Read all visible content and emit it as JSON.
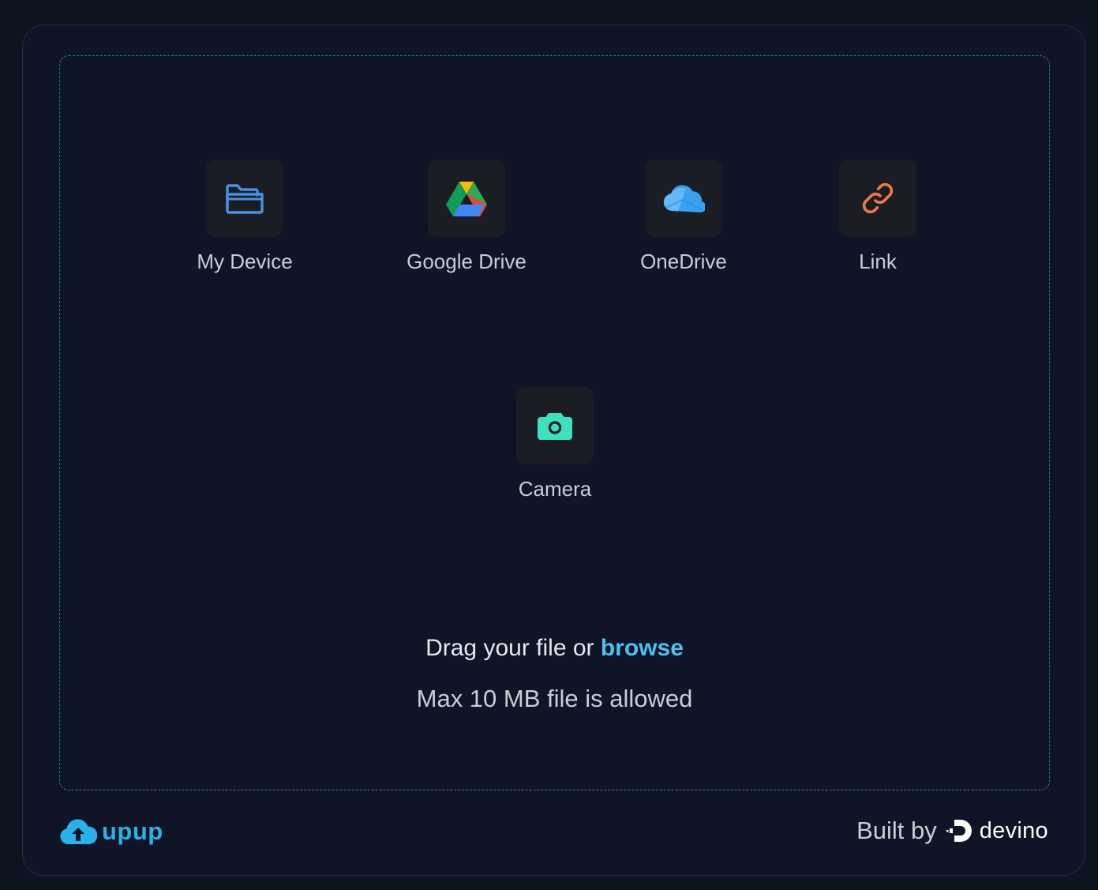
{
  "sources": [
    {
      "label": "My Device",
      "icon": "folder-open-icon",
      "color": "#4a90e2"
    },
    {
      "label": "Google Drive",
      "icon": "google-drive-icon",
      "color": "#34a853"
    },
    {
      "label": "OneDrive",
      "icon": "onedrive-icon",
      "color": "#3aa0f0"
    },
    {
      "label": "Link",
      "icon": "link-icon",
      "color": "#f27a45"
    },
    {
      "label": "Camera",
      "icon": "camera-icon",
      "color": "#3ee0c0"
    }
  ],
  "dropzone": {
    "drag_text": "Drag your file or",
    "browse_label": "browse",
    "limit_text": "Max 10 MB file is allowed"
  },
  "footer": {
    "brand_name": "upup",
    "built_by_label": "Built by",
    "credit_name": "devino"
  },
  "colors": {
    "accent": "#4cc0f1",
    "dashed_border": "#1e7aa6"
  }
}
